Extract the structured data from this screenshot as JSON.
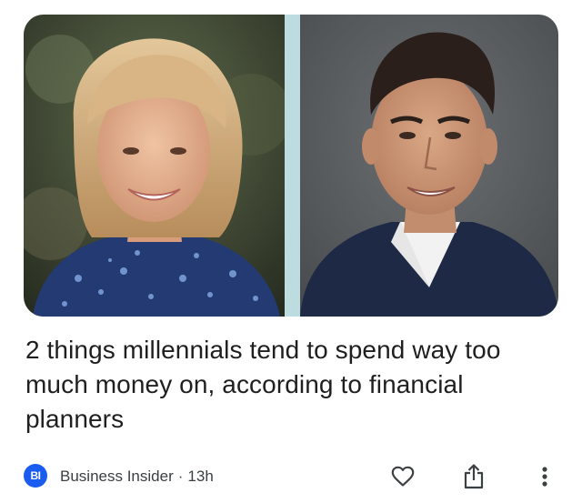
{
  "article": {
    "headline": "2 things millennials tend to spend way too much money on, according to financial planners",
    "source": {
      "logo_text": "BI",
      "name": "Business Insider",
      "separator": "·",
      "time": "13h"
    },
    "images": [
      {
        "name": "photo-woman",
        "description_icon": "person-photo"
      },
      {
        "name": "photo-man",
        "description_icon": "person-photo"
      }
    ]
  },
  "actions": [
    {
      "name": "like",
      "icon": "heart-icon"
    },
    {
      "name": "share",
      "icon": "share-icon"
    },
    {
      "name": "more",
      "icon": "more-vert-icon"
    }
  ],
  "colors": {
    "logo_bg": "#1a5bf0",
    "headline": "#1f1f1f",
    "meta": "#3c4043",
    "icon": "#3c4043",
    "strip": "#bcdcdf"
  }
}
